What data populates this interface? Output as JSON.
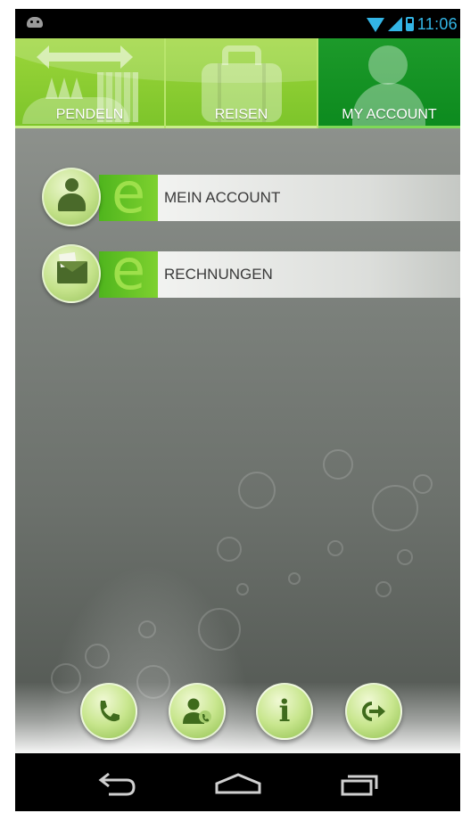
{
  "status_bar": {
    "time": "11:06",
    "icons": [
      "android-icon",
      "wifi-icon",
      "signal-icon",
      "battery-icon"
    ],
    "accent_color": "#33b5e5"
  },
  "tabs": [
    {
      "label": "PENDELN",
      "icon": "commute-icon",
      "active": false
    },
    {
      "label": "REISEN",
      "icon": "suitcase-icon",
      "active": false
    },
    {
      "label": "MY ACCOUNT",
      "icon": "account-icon",
      "active": true
    }
  ],
  "menu": [
    {
      "label": "MEIN ACCOUNT",
      "icon": "person-icon",
      "badge": "e"
    },
    {
      "label": "RECHNUNGEN",
      "icon": "envelope-icon",
      "badge": "e"
    }
  ],
  "actions": [
    {
      "icon": "phone-icon"
    },
    {
      "icon": "contact-icon"
    },
    {
      "icon": "info-icon",
      "glyph": "i"
    },
    {
      "icon": "logout-icon"
    }
  ],
  "nav": {
    "icons": [
      "back-icon",
      "home-icon",
      "recent-apps-icon"
    ]
  },
  "colors": {
    "tab_inactive": "#8bcf33",
    "tab_active": "#138f22",
    "menu_accent": "#6ac52a",
    "background": "#7d827d"
  }
}
